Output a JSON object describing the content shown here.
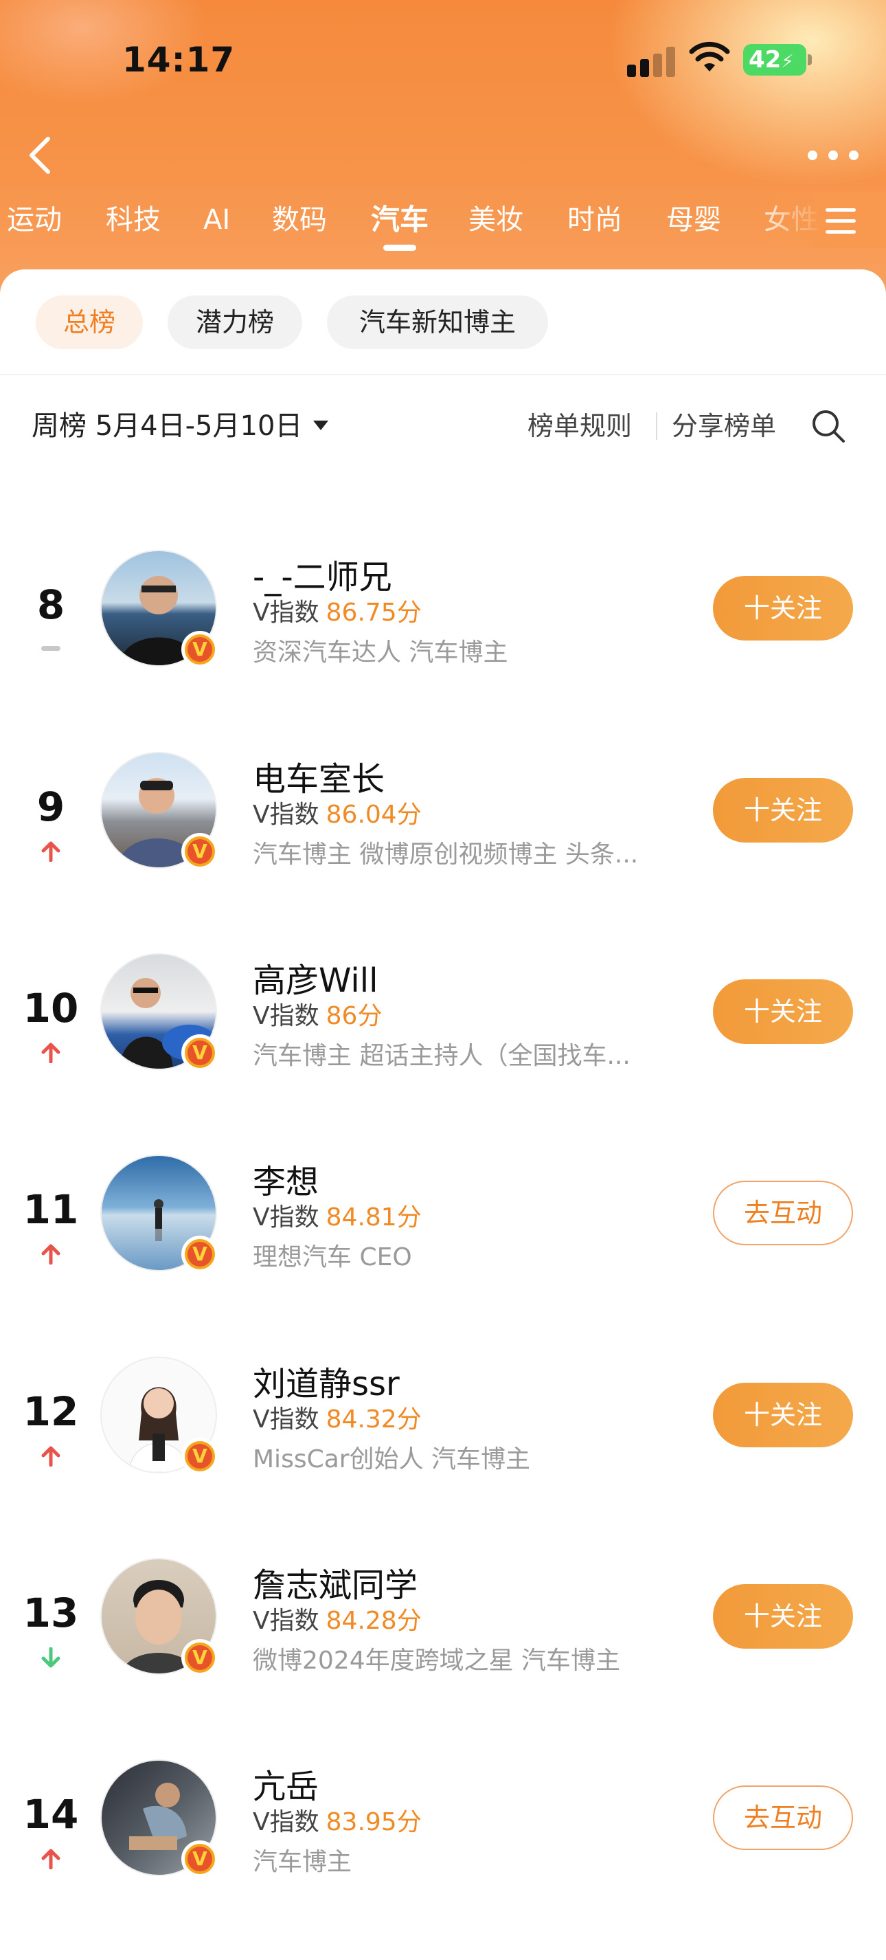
{
  "status_bar": {
    "time": "14:17",
    "battery": "42"
  },
  "categories": [
    "运动",
    "科技",
    "AI",
    "数码",
    "汽车",
    "美妆",
    "时尚",
    "母婴",
    "女性"
  ],
  "active_category": "汽车",
  "tabs": [
    {
      "label": "总榜",
      "active": true
    },
    {
      "label": "潜力榜",
      "active": false
    },
    {
      "label": "汽车新知博主",
      "active": false
    }
  ],
  "period": {
    "label": "周榜 5月4日-5月10日"
  },
  "links": {
    "rules": "榜单规则",
    "share": "分享榜单"
  },
  "score_label": "V指数",
  "rows": [
    {
      "rank": "8",
      "trend": "flat",
      "name": "-_-二师兄",
      "score": "86.75分",
      "desc": "资深汽车达人 汽车博主",
      "action": "十关注",
      "action_type": "follow"
    },
    {
      "rank": "9",
      "trend": "up",
      "name": "电车室长",
      "score": "86.04分",
      "desc": "汽车博主 微博原创视频博主 头条...",
      "action": "十关注",
      "action_type": "follow"
    },
    {
      "rank": "10",
      "trend": "up",
      "name": "高彦Will",
      "score": "86分",
      "desc": "汽车博主 超话主持人（全国找车...",
      "action": "十关注",
      "action_type": "follow"
    },
    {
      "rank": "11",
      "trend": "up",
      "name": "李想",
      "score": "84.81分",
      "desc": "理想汽车 CEO",
      "action": "去互动",
      "action_type": "interact"
    },
    {
      "rank": "12",
      "trend": "up",
      "name": "刘道静ssr",
      "score": "84.32分",
      "desc": "MissCar创始人 汽车博主",
      "action": "十关注",
      "action_type": "follow"
    },
    {
      "rank": "13",
      "trend": "down",
      "name": "詹志斌同学",
      "score": "84.28分",
      "desc": "微博2024年度跨域之星 汽车博主",
      "action": "十关注",
      "action_type": "follow"
    },
    {
      "rank": "14",
      "trend": "up",
      "name": "亢岳",
      "score": "83.95分",
      "desc": "汽车博主",
      "action": "去互动",
      "action_type": "interact"
    }
  ],
  "colors": {
    "accent": "#f07f22",
    "up": "#e8534a",
    "down": "#4cc87a",
    "header": "#f58a3c"
  }
}
